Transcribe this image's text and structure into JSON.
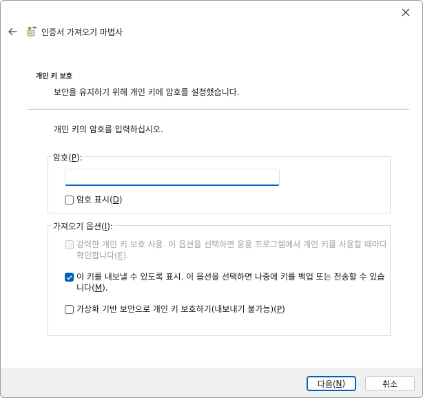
{
  "window": {
    "title": "인증서 가져오기 마법사"
  },
  "icons": {
    "close": "close-icon",
    "back": "back-arrow-icon",
    "wizard": "certificate-wizard-icon"
  },
  "header": {
    "section_title": "개인 키 보호",
    "section_desc": "보안을 유지하기 위해 개인 키에 암호를 설정했습니다."
  },
  "main": {
    "instruction": "개인 키의 암호를 입력하십시오.",
    "password_group": {
      "legend_pre": "암호(",
      "legend_key": "P",
      "legend_post": "):",
      "input_value": "",
      "show_password": {
        "label_pre": "암호 표시(",
        "label_key": "D",
        "label_post": ")",
        "checked": false
      }
    },
    "options_group": {
      "legend_pre": "가져오기 옵션(",
      "legend_key": "I",
      "legend_post": "):",
      "strong_protection": {
        "label_pre": "강력한 개인 키 보호 사용. 이 옵션을 선택하면 응용 프로그램에서 개인 키를 사용할 때마다 확인합니다(",
        "label_key": "E",
        "label_post": ").",
        "checked": false,
        "disabled": true
      },
      "exportable": {
        "label_pre": "이 키를 내보낼 수 있도록 표시. 이 옵션을 선택하면 나중에 키를 백업 또는 전송할 수 있습니다(",
        "label_key": "M",
        "label_post": ").",
        "checked": true
      },
      "vbs_protect": {
        "label_pre": "가상화 기반 보안으로 개인 키 보호하기(내보내기 불가능)(",
        "label_key": "P",
        "label_post": ")",
        "checked": false
      }
    }
  },
  "footer": {
    "next_pre": "다음(",
    "next_key": "N",
    "next_post": ")",
    "cancel": "취소"
  },
  "colors": {
    "accent": "#005fb8",
    "footer_bg": "#f0f0f0",
    "disabled_text": "#a0a0a0"
  }
}
